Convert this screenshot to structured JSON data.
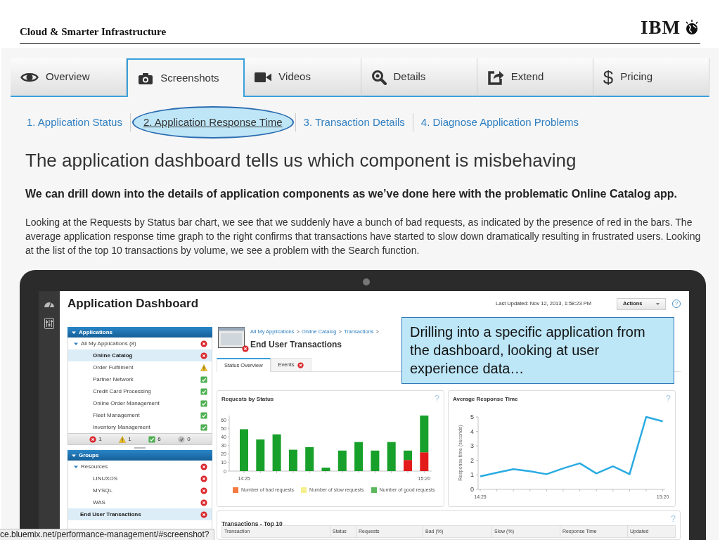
{
  "header": {
    "title": "Cloud & Smarter Infrastructure",
    "logo": "IBM"
  },
  "tabs": [
    {
      "label": "Overview",
      "kind": "eye",
      "selected": false
    },
    {
      "label": "Screenshots",
      "kind": "camera",
      "selected": true
    },
    {
      "label": "Videos",
      "kind": "video",
      "selected": false
    },
    {
      "label": "Details",
      "kind": "search",
      "selected": false
    },
    {
      "label": "Extend",
      "kind": "export",
      "selected": false
    },
    {
      "label": "Pricing",
      "glyph": "$",
      "selected": false
    }
  ],
  "steps": [
    {
      "label": "1. Application Status",
      "selected": false
    },
    {
      "label": "2. Application Response Time",
      "selected": true
    },
    {
      "label": "3. Transaction Details",
      "selected": false
    },
    {
      "label": "4. Diagnose Application Problems",
      "selected": false
    }
  ],
  "heading": "The application dashboard tells us which component is misbehaving",
  "lead": "We can drill down into the details of application components as we’ve done here with the problematic Online Catalog app.",
  "body": "Looking at the Requests by Status bar chart, we see that we suddenly have a bunch of bad requests, as indicated by the presence of red in the bars. The average application response time graph to the right confirms that transactions have started to slow down dramatically resulting in frustrated users. Looking at the list of the top 10 transactions by volume, we see a problem with the Search function.",
  "dashboard": {
    "title": "Application Dashboard",
    "last_updated": "Last Updated: Nov 12, 2013, 1:58:23 PM",
    "actions": "Actions",
    "help": "?",
    "applications": {
      "label": "Applications",
      "expanded": true,
      "items": [
        {
          "label": "All My Applications (8)",
          "kind": "error",
          "expanded": true,
          "selected": false,
          "children": [
            {
              "label": "Online Catalog",
              "kind": "error",
              "selected": true
            },
            {
              "label": "Order Fulfilment",
              "kind": "warning",
              "selected": false
            },
            {
              "label": "Partner Network",
              "kind": "ok",
              "selected": false
            },
            {
              "label": "Credit Card Processing",
              "kind": "ok",
              "selected": false
            },
            {
              "label": "Online Order Management",
              "kind": "ok",
              "selected": false
            },
            {
              "label": "Fleet Management",
              "kind": "ok",
              "selected": false
            },
            {
              "label": "Inventory Management",
              "kind": "ok",
              "selected": false
            }
          ]
        }
      ]
    },
    "summary": [
      {
        "kind": "error",
        "count": "1"
      },
      {
        "kind": "warning",
        "count": "1"
      },
      {
        "kind": "ok",
        "count": "6"
      },
      {
        "kind": "unknown",
        "count": "0"
      }
    ],
    "groups": {
      "label": "Groups",
      "expanded": true,
      "items": [
        {
          "label": "Resources",
          "kind": "error",
          "expanded": true,
          "selected": false,
          "children": [
            {
              "label": "LINUXOS",
              "kind": "error",
              "selected": false
            },
            {
              "label": "MYSQL",
              "kind": "error",
              "selected": false
            },
            {
              "label": "WAS",
              "kind": "error",
              "selected": false
            }
          ]
        },
        {
          "label": "End User Transactions",
          "kind": "error",
          "selected": true
        }
      ]
    },
    "breadcrumb": {
      "items": [
        "All My Applications",
        "Online Catalog",
        "Transactions"
      ],
      "separator": ">"
    },
    "page": {
      "title": "End User Transactions",
      "kind": "error"
    },
    "view_tabs": [
      {
        "label": "Status Overview",
        "selected": true
      },
      {
        "label": "Events",
        "kind": "error",
        "selected": false
      }
    ],
    "requests_chart": {
      "title": "Requests by Status",
      "help": "?",
      "legend": [
        {
          "label": "Number of bad requests",
          "color": "#f47a42"
        },
        {
          "label": "Number of slow requests",
          "color": "#f4f08c"
        },
        {
          "label": "Number of good requests",
          "color": "#5cb85c"
        }
      ],
      "chart_data": {
        "type": "bar",
        "stacked": true,
        "categories": [
          "14:25",
          null,
          null,
          null,
          null,
          null,
          null,
          null,
          null,
          null,
          null,
          "15:20"
        ],
        "yticks": [
          0,
          10,
          20,
          30,
          40,
          50,
          60
        ],
        "ylim": [
          0,
          65
        ],
        "series": [
          {
            "color": "#e31b1b",
            "values": [
              0,
              0,
              0,
              0,
              0,
              0,
              0,
              0,
              0,
              0,
              13,
              22
            ]
          },
          {
            "color": "#17a02a",
            "values": [
              49,
              37,
              43,
              25,
              28,
              4,
              24,
              34,
              24,
              34,
              11,
              43
            ]
          }
        ]
      }
    },
    "response_chart": {
      "title": "Average Response Time",
      "help": "?",
      "chart_data": {
        "type": "line",
        "ylabel": "Response time (seconds)",
        "categories": [
          "14:25",
          null,
          null,
          null,
          null,
          null,
          null,
          null,
          null,
          null,
          null,
          "15:20"
        ],
        "yticks": [
          0,
          1,
          2,
          3,
          4,
          5
        ],
        "ylim": [
          0,
          5
        ],
        "series": [
          {
            "color": "#29abe2",
            "values": [
              0.9,
              1.15,
              1.4,
              1.25,
              1.05,
              1.45,
              1.8,
              1.1,
              1.6,
              1.05,
              5,
              4.7
            ]
          }
        ]
      }
    },
    "transactions": {
      "title": "Transactions - Top 10",
      "help": "?",
      "columns": [
        "Transaction",
        "Status",
        "Requests",
        "Bad (%)",
        "Slow (%)",
        "Response Time",
        "Updated"
      ]
    }
  },
  "callout": "Drilling into a specific application from the dashboard, looking at user experience data…",
  "status_url": "ce.bluemix.net/performance-management/#screenshot?"
}
